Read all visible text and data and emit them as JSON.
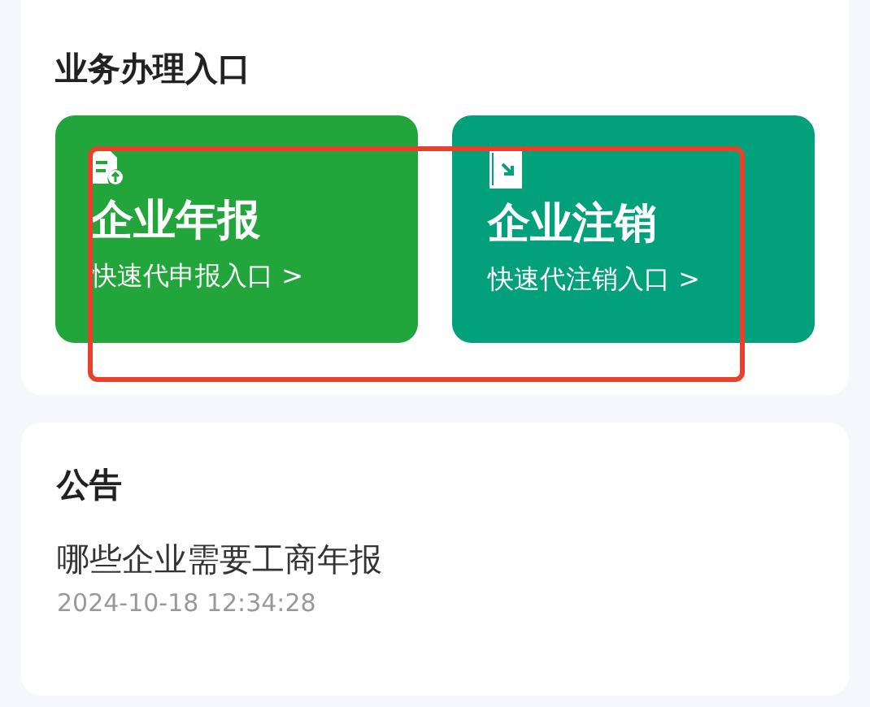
{
  "business": {
    "title": "业务办理入口",
    "tiles": [
      {
        "kind": "report",
        "color": "#22a53a",
        "title": "企业年报",
        "subtitle": "快速代申报入口 >"
      },
      {
        "kind": "cancel",
        "color": "#03a07c",
        "title": "企业注销",
        "subtitle": "快速代注销入口 >"
      }
    ]
  },
  "notice": {
    "title": "公告",
    "items": [
      {
        "title": "哪些企业需要工商年报",
        "time": "2024-10-18 12:34:28"
      }
    ]
  }
}
